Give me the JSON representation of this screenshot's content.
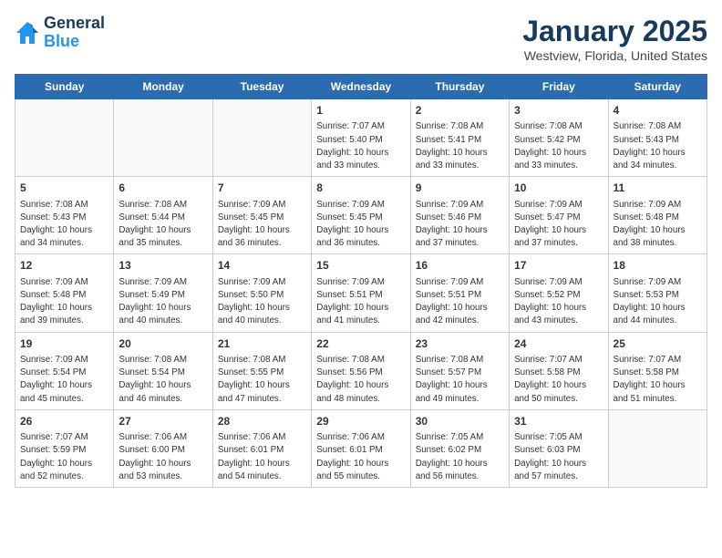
{
  "header": {
    "logo_line1": "General",
    "logo_line2": "Blue",
    "month": "January 2025",
    "location": "Westview, Florida, United States"
  },
  "days_of_week": [
    "Sunday",
    "Monday",
    "Tuesday",
    "Wednesday",
    "Thursday",
    "Friday",
    "Saturday"
  ],
  "weeks": [
    [
      {
        "num": "",
        "info": ""
      },
      {
        "num": "",
        "info": ""
      },
      {
        "num": "",
        "info": ""
      },
      {
        "num": "1",
        "info": "Sunrise: 7:07 AM\nSunset: 5:40 PM\nDaylight: 10 hours\nand 33 minutes."
      },
      {
        "num": "2",
        "info": "Sunrise: 7:08 AM\nSunset: 5:41 PM\nDaylight: 10 hours\nand 33 minutes."
      },
      {
        "num": "3",
        "info": "Sunrise: 7:08 AM\nSunset: 5:42 PM\nDaylight: 10 hours\nand 33 minutes."
      },
      {
        "num": "4",
        "info": "Sunrise: 7:08 AM\nSunset: 5:43 PM\nDaylight: 10 hours\nand 34 minutes."
      }
    ],
    [
      {
        "num": "5",
        "info": "Sunrise: 7:08 AM\nSunset: 5:43 PM\nDaylight: 10 hours\nand 34 minutes."
      },
      {
        "num": "6",
        "info": "Sunrise: 7:08 AM\nSunset: 5:44 PM\nDaylight: 10 hours\nand 35 minutes."
      },
      {
        "num": "7",
        "info": "Sunrise: 7:09 AM\nSunset: 5:45 PM\nDaylight: 10 hours\nand 36 minutes."
      },
      {
        "num": "8",
        "info": "Sunrise: 7:09 AM\nSunset: 5:45 PM\nDaylight: 10 hours\nand 36 minutes."
      },
      {
        "num": "9",
        "info": "Sunrise: 7:09 AM\nSunset: 5:46 PM\nDaylight: 10 hours\nand 37 minutes."
      },
      {
        "num": "10",
        "info": "Sunrise: 7:09 AM\nSunset: 5:47 PM\nDaylight: 10 hours\nand 37 minutes."
      },
      {
        "num": "11",
        "info": "Sunrise: 7:09 AM\nSunset: 5:48 PM\nDaylight: 10 hours\nand 38 minutes."
      }
    ],
    [
      {
        "num": "12",
        "info": "Sunrise: 7:09 AM\nSunset: 5:48 PM\nDaylight: 10 hours\nand 39 minutes."
      },
      {
        "num": "13",
        "info": "Sunrise: 7:09 AM\nSunset: 5:49 PM\nDaylight: 10 hours\nand 40 minutes."
      },
      {
        "num": "14",
        "info": "Sunrise: 7:09 AM\nSunset: 5:50 PM\nDaylight: 10 hours\nand 40 minutes."
      },
      {
        "num": "15",
        "info": "Sunrise: 7:09 AM\nSunset: 5:51 PM\nDaylight: 10 hours\nand 41 minutes."
      },
      {
        "num": "16",
        "info": "Sunrise: 7:09 AM\nSunset: 5:51 PM\nDaylight: 10 hours\nand 42 minutes."
      },
      {
        "num": "17",
        "info": "Sunrise: 7:09 AM\nSunset: 5:52 PM\nDaylight: 10 hours\nand 43 minutes."
      },
      {
        "num": "18",
        "info": "Sunrise: 7:09 AM\nSunset: 5:53 PM\nDaylight: 10 hours\nand 44 minutes."
      }
    ],
    [
      {
        "num": "19",
        "info": "Sunrise: 7:09 AM\nSunset: 5:54 PM\nDaylight: 10 hours\nand 45 minutes."
      },
      {
        "num": "20",
        "info": "Sunrise: 7:08 AM\nSunset: 5:54 PM\nDaylight: 10 hours\nand 46 minutes."
      },
      {
        "num": "21",
        "info": "Sunrise: 7:08 AM\nSunset: 5:55 PM\nDaylight: 10 hours\nand 47 minutes."
      },
      {
        "num": "22",
        "info": "Sunrise: 7:08 AM\nSunset: 5:56 PM\nDaylight: 10 hours\nand 48 minutes."
      },
      {
        "num": "23",
        "info": "Sunrise: 7:08 AM\nSunset: 5:57 PM\nDaylight: 10 hours\nand 49 minutes."
      },
      {
        "num": "24",
        "info": "Sunrise: 7:07 AM\nSunset: 5:58 PM\nDaylight: 10 hours\nand 50 minutes."
      },
      {
        "num": "25",
        "info": "Sunrise: 7:07 AM\nSunset: 5:58 PM\nDaylight: 10 hours\nand 51 minutes."
      }
    ],
    [
      {
        "num": "26",
        "info": "Sunrise: 7:07 AM\nSunset: 5:59 PM\nDaylight: 10 hours\nand 52 minutes."
      },
      {
        "num": "27",
        "info": "Sunrise: 7:06 AM\nSunset: 6:00 PM\nDaylight: 10 hours\nand 53 minutes."
      },
      {
        "num": "28",
        "info": "Sunrise: 7:06 AM\nSunset: 6:01 PM\nDaylight: 10 hours\nand 54 minutes."
      },
      {
        "num": "29",
        "info": "Sunrise: 7:06 AM\nSunset: 6:01 PM\nDaylight: 10 hours\nand 55 minutes."
      },
      {
        "num": "30",
        "info": "Sunrise: 7:05 AM\nSunset: 6:02 PM\nDaylight: 10 hours\nand 56 minutes."
      },
      {
        "num": "31",
        "info": "Sunrise: 7:05 AM\nSunset: 6:03 PM\nDaylight: 10 hours\nand 57 minutes."
      },
      {
        "num": "",
        "info": ""
      }
    ]
  ]
}
